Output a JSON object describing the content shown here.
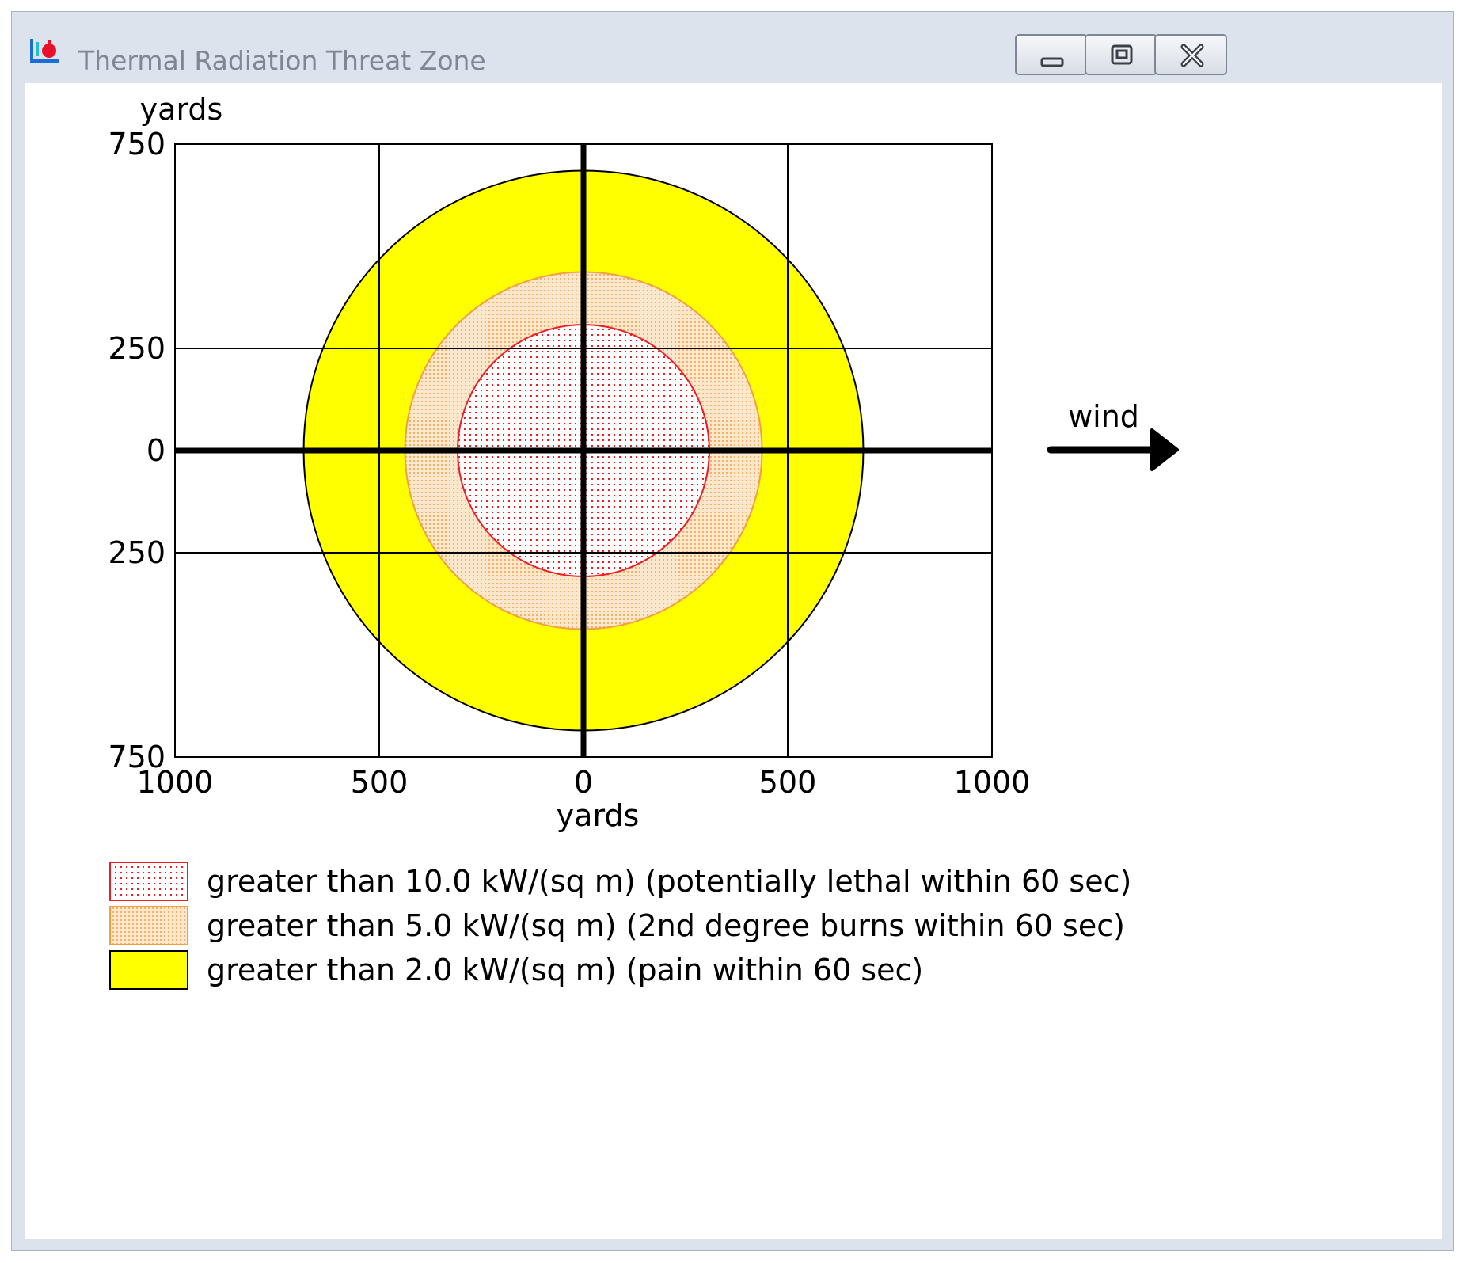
{
  "window": {
    "title": "Thermal Radiation Threat Zone",
    "controls": {
      "minimize": "minimize",
      "maximize": "maximize",
      "close": "close"
    }
  },
  "plot": {
    "y_unit_label": "yards",
    "x_unit_label": "yards",
    "y_ticks": [
      {
        "value": 750,
        "label": "750"
      },
      {
        "value": 250,
        "label": "250"
      },
      {
        "value": 0,
        "label": "0"
      },
      {
        "value": -250,
        "label": "250"
      },
      {
        "value": -750,
        "label": "750"
      }
    ],
    "x_ticks": [
      {
        "value": -1000,
        "label": "1000"
      },
      {
        "value": -500,
        "label": "500"
      },
      {
        "value": 0,
        "label": "0"
      },
      {
        "value": 500,
        "label": "500"
      },
      {
        "value": 1000,
        "label": "1000"
      }
    ],
    "xlim": [
      -1000,
      1000
    ],
    "ylim": [
      -750,
      750
    ],
    "wind_label": "wind",
    "wind_direction": "east",
    "zones": [
      {
        "key": "yellow",
        "radius_yards": 685,
        "fill": "#ffff00",
        "stroke": "#000000",
        "pattern": "solid"
      },
      {
        "key": "orange",
        "radius_yards": 437,
        "fill": "#fbe3c4",
        "stroke": "#f0a040",
        "pattern": "dots"
      },
      {
        "key": "red",
        "radius_yards": 308,
        "fill": "#ffe8ec",
        "stroke": "#ee1c24",
        "pattern": "dots"
      }
    ]
  },
  "legend": [
    {
      "label": "greater than 10.0 kW/(sq m) (potentially lethal within 60 sec)",
      "zone": "red"
    },
    {
      "label": "greater than 5.0 kW/(sq m) (2nd degree burns within 60 sec)",
      "zone": "orange"
    },
    {
      "label": "greater than 2.0 kW/(sq m) (pain within 60 sec)",
      "zone": "yellow"
    }
  ],
  "colors": {
    "lethal": "#ee1c24",
    "burns": "#f0a040",
    "pain": "#ffff00"
  }
}
